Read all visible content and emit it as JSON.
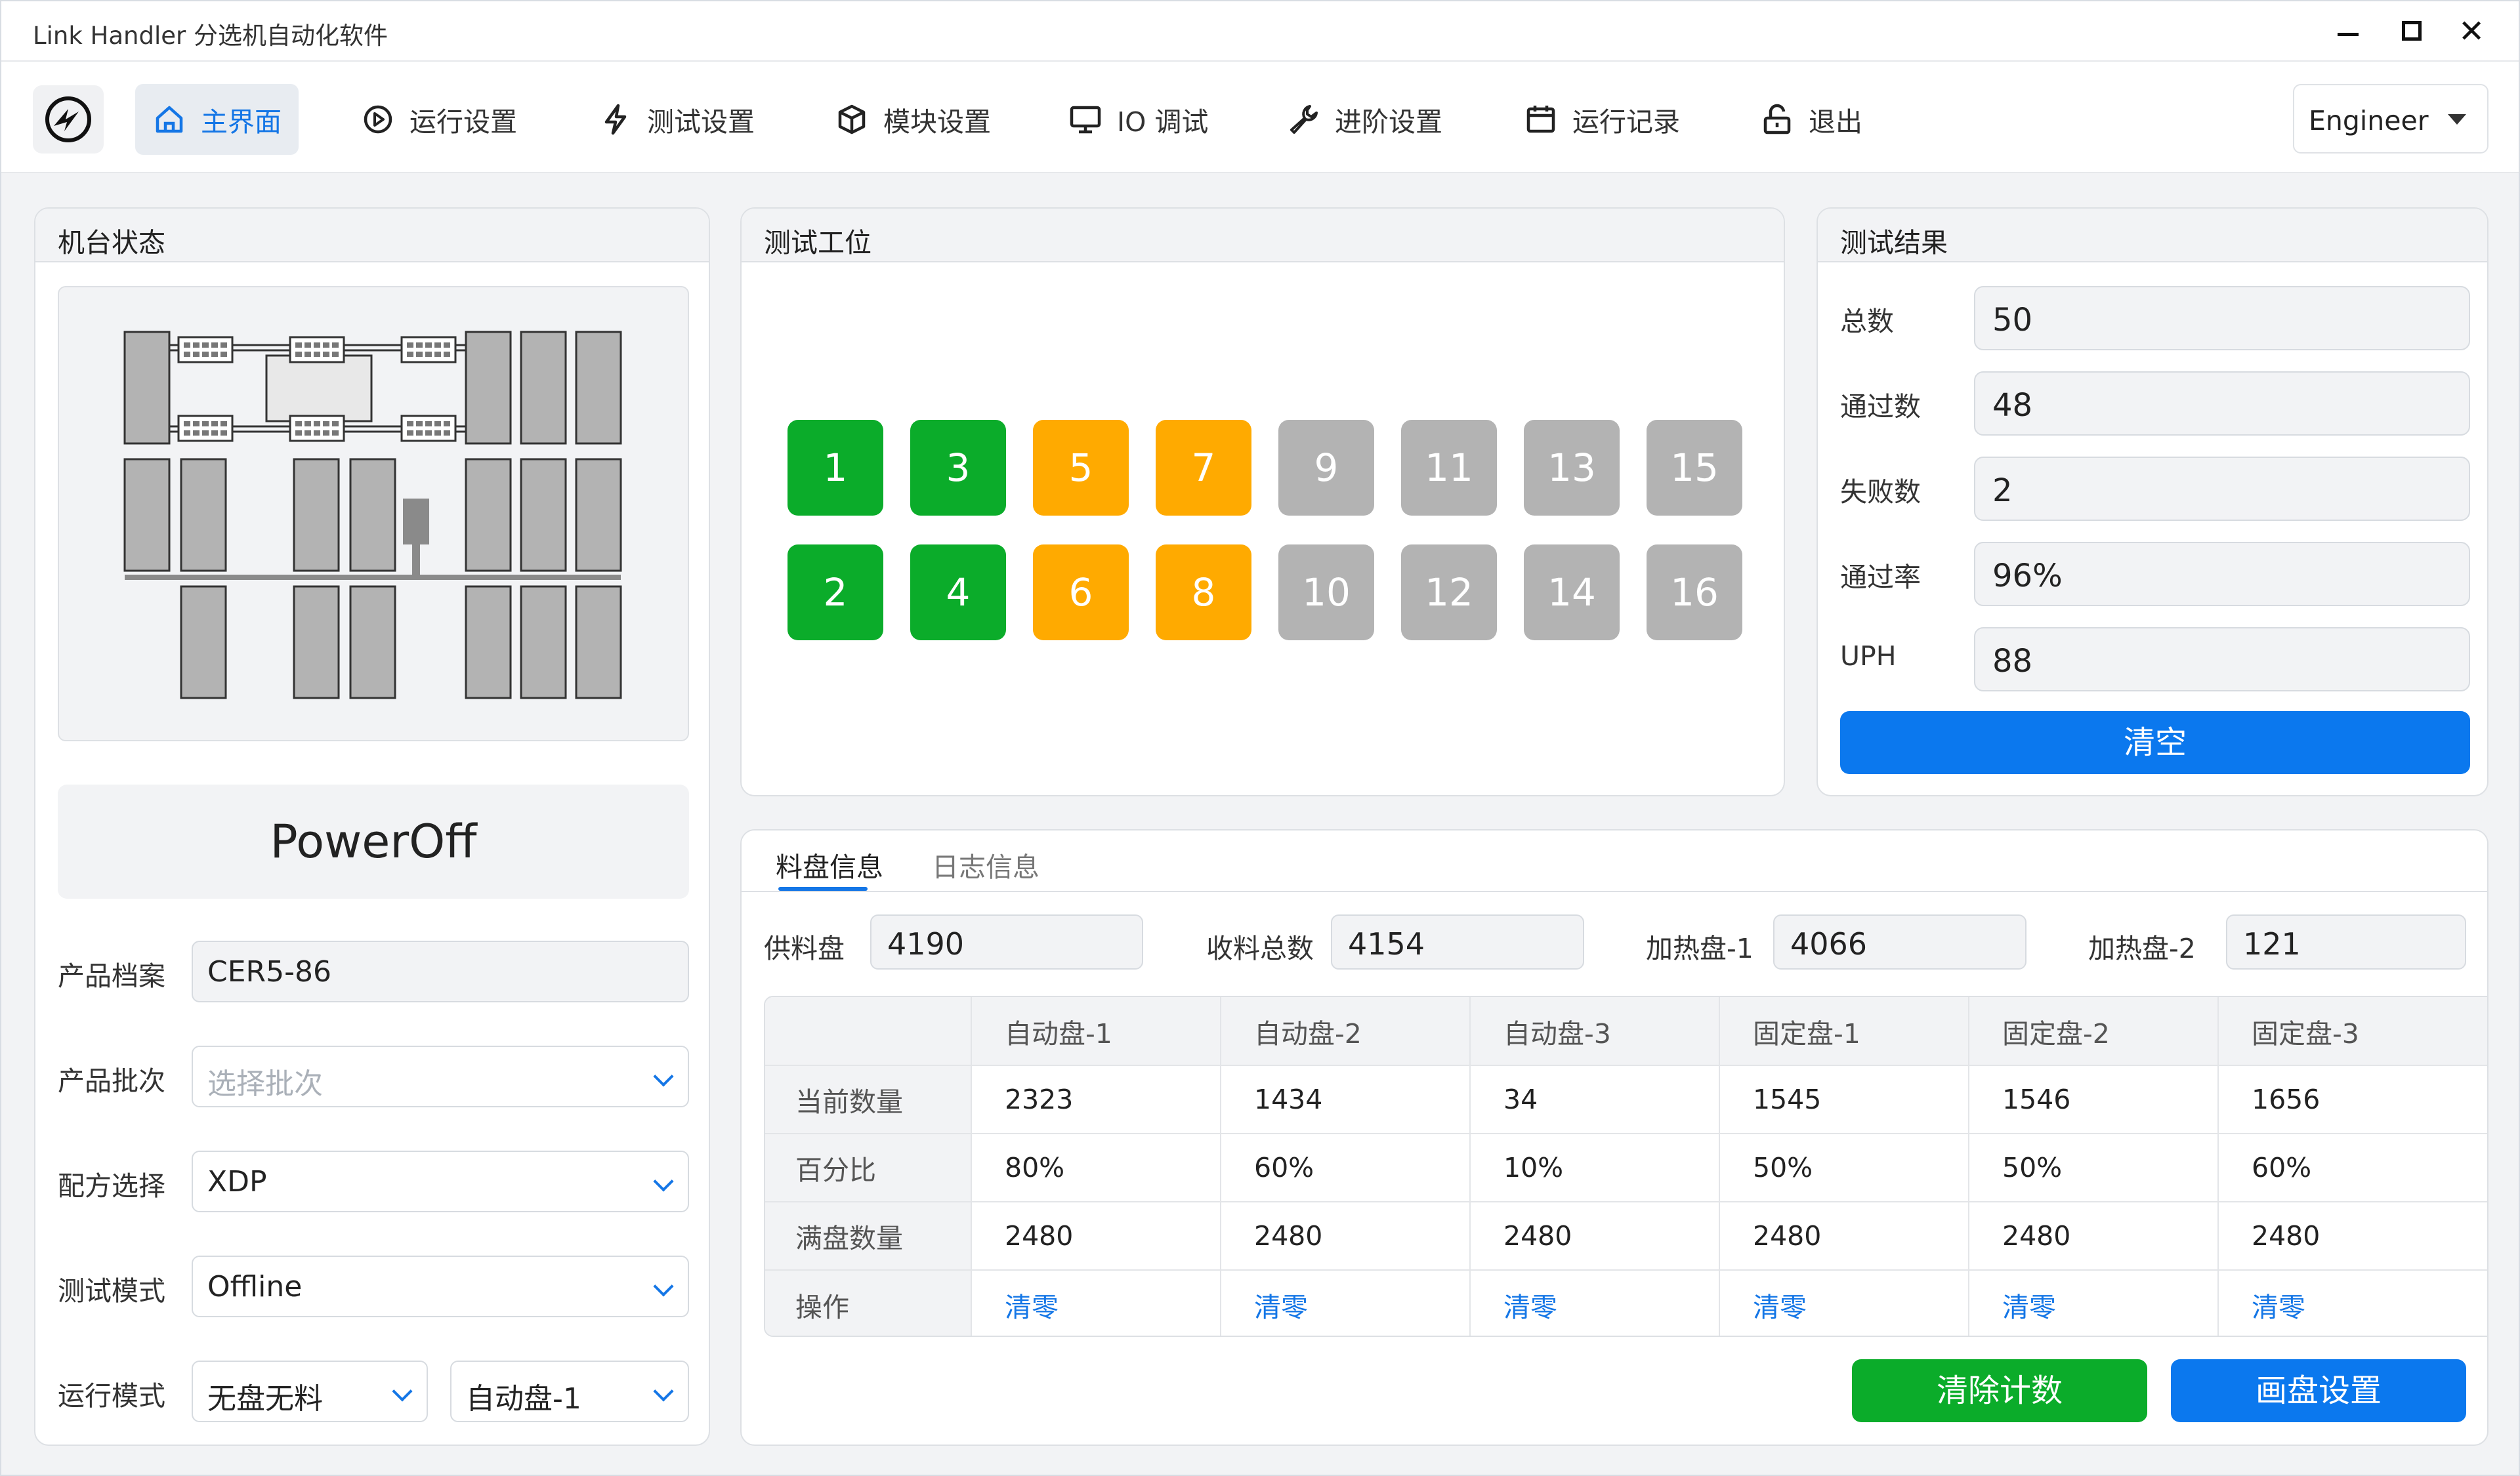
{
  "window": {
    "title": "Link Handler 分选机自动化软件"
  },
  "nav": {
    "items": [
      {
        "label": "主界面",
        "icon": "home-icon"
      },
      {
        "label": "运行设置",
        "icon": "play-circle-icon"
      },
      {
        "label": "测试设置",
        "icon": "lightning-icon"
      },
      {
        "label": "模块设置",
        "icon": "cube-icon"
      },
      {
        "label": "IO 调试",
        "icon": "monitor-icon"
      },
      {
        "label": "进阶设置",
        "icon": "wrench-icon"
      },
      {
        "label": "运行记录",
        "icon": "calendar-icon"
      },
      {
        "label": "退出",
        "icon": "unlock-icon"
      }
    ],
    "role": "Engineer"
  },
  "machine": {
    "title": "机台状态",
    "status": "PowerOff",
    "product_file_label": "产品档案",
    "product_file_value": "CER5-86",
    "batch_label": "产品批次",
    "batch_placeholder": "选择批次",
    "recipe_label": "配方选择",
    "recipe_value": "XDP",
    "test_mode_label": "测试模式",
    "test_mode_value": "Offline",
    "run_mode_label": "运行模式",
    "run_mode_value": "无盘无料",
    "run_mode_tray": "自动盘-1"
  },
  "stations": {
    "title": "测试工位",
    "items": [
      {
        "n": "1",
        "status": "pass"
      },
      {
        "n": "3",
        "status": "pass"
      },
      {
        "n": "5",
        "status": "warn"
      },
      {
        "n": "7",
        "status": "warn"
      },
      {
        "n": "9",
        "status": "idle"
      },
      {
        "n": "11",
        "status": "idle"
      },
      {
        "n": "13",
        "status": "idle"
      },
      {
        "n": "15",
        "status": "idle"
      },
      {
        "n": "2",
        "status": "pass"
      },
      {
        "n": "4",
        "status": "pass"
      },
      {
        "n": "6",
        "status": "warn"
      },
      {
        "n": "8",
        "status": "warn"
      },
      {
        "n": "10",
        "status": "idle"
      },
      {
        "n": "12",
        "status": "idle"
      },
      {
        "n": "14",
        "status": "idle"
      },
      {
        "n": "16",
        "status": "idle"
      }
    ],
    "colors": {
      "pass": "#0bac2a",
      "warn": "#ffaa00",
      "idle": "#b3b3b3"
    }
  },
  "results": {
    "title": "测试结果",
    "rows": [
      {
        "label": "总数",
        "value": "50"
      },
      {
        "label": "通过数",
        "value": "48"
      },
      {
        "label": "失败数",
        "value": "2"
      },
      {
        "label": "通过率",
        "value": "96%"
      },
      {
        "label": "UPH",
        "value": "88"
      }
    ],
    "clear_label": "清空"
  },
  "tray": {
    "tabs": [
      "料盘信息",
      "日志信息"
    ],
    "summary": [
      {
        "label": "供料盘",
        "value": "4190"
      },
      {
        "label": "收料总数",
        "value": "4154"
      },
      {
        "label": "加热盘-1",
        "value": "4066"
      },
      {
        "label": "加热盘-2",
        "value": "121"
      }
    ],
    "columns": [
      "自动盘-1",
      "自动盘-2",
      "自动盘-3",
      "固定盘-1",
      "固定盘-2",
      "固定盘-3"
    ],
    "row_labels": [
      "当前数量",
      "百分比",
      "满盘数量",
      "操作"
    ],
    "current": [
      "2323",
      "1434",
      "34",
      "1545",
      "1546",
      "1656"
    ],
    "percent": [
      "80%",
      "60%",
      "10%",
      "50%",
      "50%",
      "60%"
    ],
    "full": [
      "2480",
      "2480",
      "2480",
      "2480",
      "2480",
      "2480"
    ],
    "action_label": "清零",
    "clear_count_label": "清除计数",
    "tray_setting_label": "画盘设置"
  },
  "colors": {
    "accent": "#1476e6",
    "primary_button": "#0b78ee",
    "success": "#0bac2a",
    "warning": "#ffaa00",
    "idle": "#b3b3b3"
  }
}
